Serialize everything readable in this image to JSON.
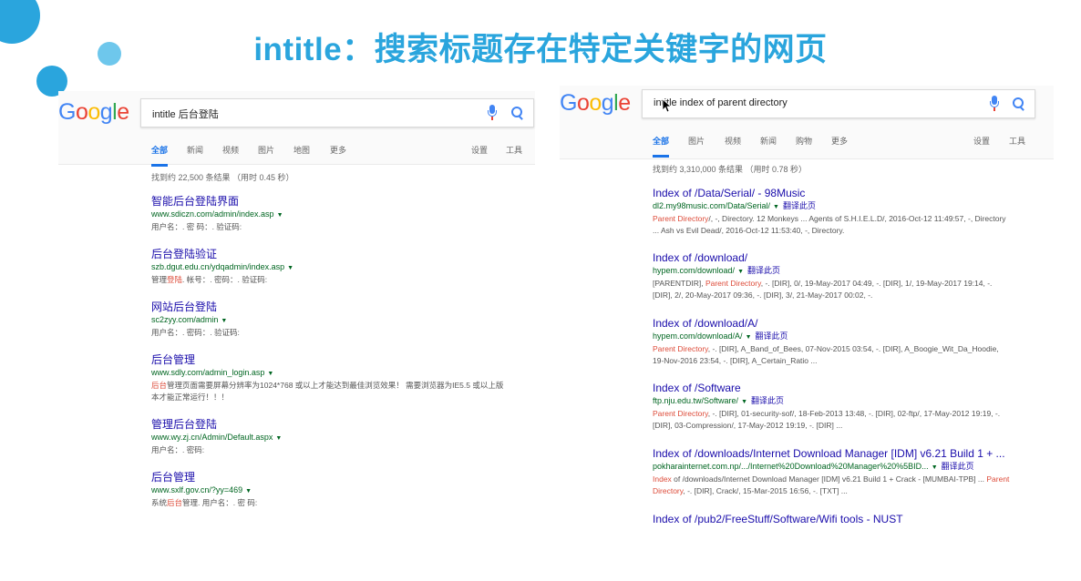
{
  "slide_title": "intitle：搜索标题存在特定关键字的网页",
  "logo_letters": [
    {
      "ch": "G",
      "color": "#4285f4"
    },
    {
      "ch": "o",
      "color": "#ea4335"
    },
    {
      "ch": "o",
      "color": "#fbbc05"
    },
    {
      "ch": "g",
      "color": "#4285f4"
    },
    {
      "ch": "l",
      "color": "#34a853"
    },
    {
      "ch": "e",
      "color": "#ea4335"
    }
  ],
  "left": {
    "query": "intitle 后台登陆",
    "tabs": [
      "全部",
      "新闻",
      "视频",
      "图片",
      "地图",
      "更多"
    ],
    "tools": [
      "设置",
      "工具"
    ],
    "stats": "找到约 22,500 条结果 （用时 0.45 秒）",
    "results": [
      {
        "title": "智能后台登陆界面",
        "url": "www.sdiczn.com/admin/index.asp",
        "snippet": "用户名：. 密 码：. 验证码:"
      },
      {
        "title": "后台登陆验证",
        "url": "szb.dgut.edu.cn/ydqadmin/index.asp",
        "snippet_pre": "管理",
        "snippet_red": "登陆",
        "snippet_post": ". 帐号：. 密码：. 验证码:"
      },
      {
        "title": "网站后台登陆",
        "url": "sc2zyy.com/admin",
        "snippet": "用户名：. 密码：. 验证码:"
      },
      {
        "title": "后台管理",
        "url": "www.sdly.com/admin_login.asp",
        "snippet_red": "后台",
        "snippet_post": "管理页面需要屏幕分辨率为1024*768 或以上才能达到最佳浏览效果！ 需要浏览器为IE5.5 或以上版",
        "snippet2": "本才能正常运行！！！"
      },
      {
        "title": "管理后台登陆",
        "url": "www.wy.zj.cn/Admin/Default.aspx",
        "snippet": "用户名：. 密码:"
      },
      {
        "title": "后台管理",
        "url": "www.sxlf.gov.cn/?yy=469",
        "snippet_pre": "系统",
        "snippet_red": "后台",
        "snippet_post": "管理. 用户名：. 密 码:"
      }
    ]
  },
  "right": {
    "query": "intitle index of parent directory",
    "tabs": [
      "全部",
      "图片",
      "视频",
      "新闻",
      "购物",
      "更多"
    ],
    "tools": [
      "设置",
      "工具"
    ],
    "stats": "找到约 3,310,000 条结果 （用时 0.78 秒）",
    "translate": "翻译此页",
    "results": [
      {
        "title": "Index of /Data/Serial/ - 98Music",
        "url": "dl2.my98music.com/Data/Serial/",
        "l1_red": "Parent Directory",
        "l1": "/, -, Directory. 12 Monkeys ... Agents of S.H.I.E.L.D/, 2016-Oct-12 11:49:57, -, Directory",
        "l2": "... Ash vs Evil Dead/, 2016-Oct-12 11:53:40, -, Directory."
      },
      {
        "title": "Index of /download/",
        "url": "hypem.com/download/",
        "l1_pre": "[PARENTDIR], ",
        "l1_red": "Parent Directory",
        "l1": ", -. [DIR], 0/, 19-May-2017 04:49, -. [DIR], 1/, 19-May-2017 19:14, -.",
        "l2": "[DIR], 2/, 20-May-2017 09:36, -. [DIR], 3/, 21-May-2017 00:02, -."
      },
      {
        "title": "Index of /download/A/",
        "url": "hypem.com/download/A/",
        "l1_red": "Parent Directory",
        "l1": ", -. [DIR], A_Band_of_Bees, 07-Nov-2015 03:54, -. [DIR], A_Boogie_Wit_Da_Hoodie,",
        "l2": "19-Nov-2016 23:54, -. [DIR], A_Certain_Ratio ..."
      },
      {
        "title": "Index of /Software",
        "url": "ftp.nju.edu.tw/Software/",
        "l1_red": "Parent Directory",
        "l1": ", -. [DIR], 01-security-sof/, 18-Feb-2013 13:48, -. [DIR], 02-ftp/, 17-May-2012 19:19, -.",
        "l2": "[DIR], 03-Compression/, 17-May-2012 19:19, -. [DIR] ..."
      },
      {
        "title": "Index of /downloads/Internet Download Manager [IDM] v6.21 Build 1 + ...",
        "url": "pokharainternet.com.np/.../Internet%20Download%20Manager%20%5BID...",
        "l1_red": "Index",
        "l1": " of /downloads/Internet Download Manager [IDM] v6.21 Build 1 + Crack - [MUMBAI-TPB] ... ",
        "l1_red2": "Parent",
        "l2_red": "Directory",
        "l2": ", -. [DIR], Crack/, 15-Mar-2015 16:56, -. [TXT] ..."
      },
      {
        "title": "Index of /pub2/FreeStuff/Software/Wifi tools - NUST"
      }
    ]
  }
}
